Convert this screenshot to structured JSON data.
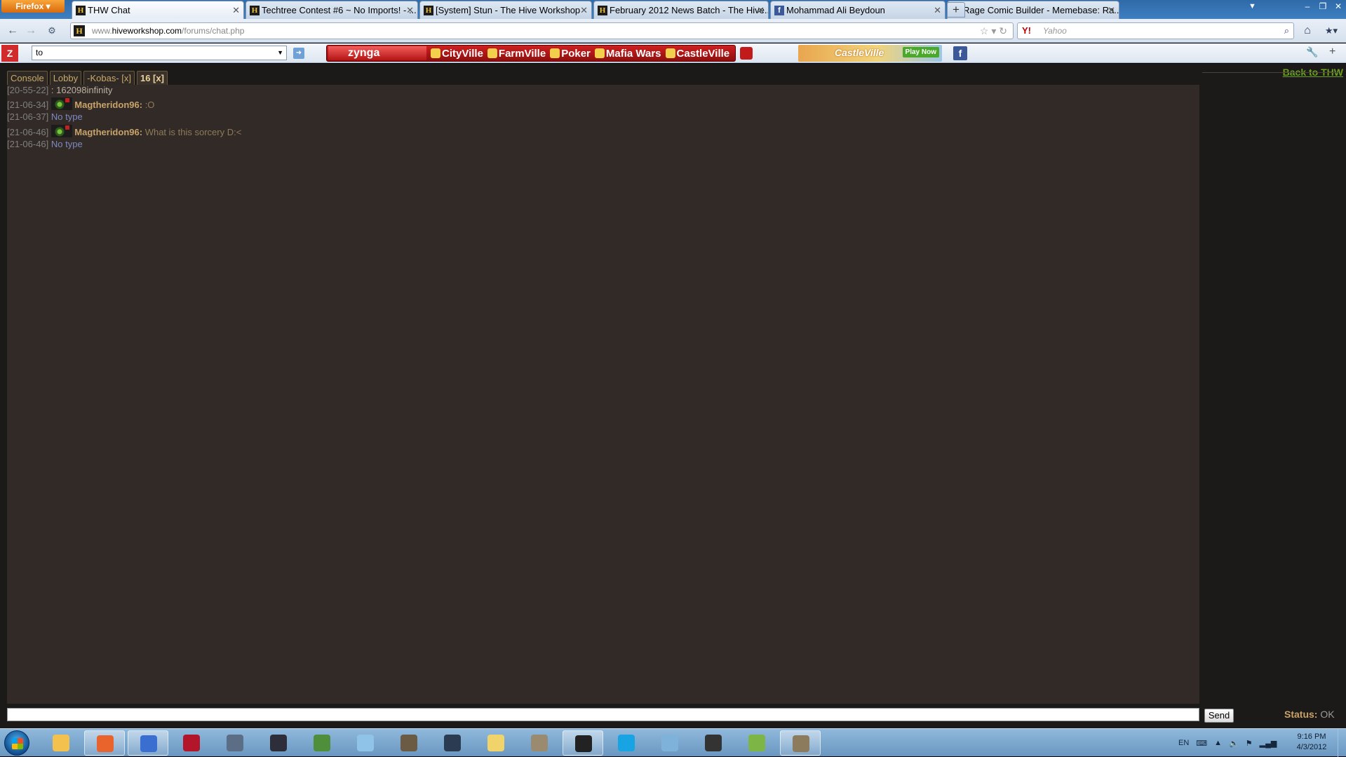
{
  "browser": {
    "menu_label": "Firefox",
    "tabs": [
      {
        "title": "THW Chat",
        "icon": "H"
      },
      {
        "title": "Techtree Contest #6 ~ No Imports! - ...",
        "icon": "H"
      },
      {
        "title": "[System] Stun - The Hive Workshop",
        "icon": "H"
      },
      {
        "title": "February 2012 News Batch - The Hive...",
        "icon": "H"
      },
      {
        "title": "Mohammad Ali Beydoun",
        "icon": "f"
      },
      {
        "title": "Rage Comic Builder - Memebase: Ra...",
        "icon": "M"
      }
    ],
    "url_prefix": "www.",
    "url_host": "hiveworkshop.com",
    "url_path": "/forums/chat.php",
    "search_engine": "Y!",
    "search_placeholder": "Yahoo"
  },
  "zynga_toolbar": {
    "search_value": "to",
    "logo": "zynga",
    "games": [
      "CityVille",
      "FarmVille",
      "Poker",
      "Mafia Wars",
      "CastleVille"
    ],
    "banner_title": "CastleVille",
    "banner_button": "Play Now",
    "fb_badge": "f"
  },
  "chat": {
    "tabs": [
      "Console",
      "Lobby",
      "-Kobas- [x]",
      "16 [x]"
    ],
    "back_link": "Back to THW",
    "messages": [
      {
        "ts": "[20-55-22]",
        "nick": "",
        "text": ": 162098infinity",
        "type": "plain"
      },
      {
        "ts": "[21-06-34]",
        "nick": "Magtheridon96:",
        "text": ":O",
        "type": "user"
      },
      {
        "ts": "[21-06-37]",
        "nick": "",
        "text": "No type",
        "type": "system"
      },
      {
        "ts": "[21-06-46]",
        "nick": "Magtheridon96:",
        "text": "What is this sorcery D:<",
        "type": "user"
      },
      {
        "ts": "[21-06-46]",
        "nick": "",
        "text": "No type",
        "type": "system"
      }
    ],
    "input_value": "",
    "send_label": "Send",
    "status_label": "Status:",
    "status_value": "OK"
  },
  "taskbar": {
    "lang": "EN",
    "time": "9:16 PM",
    "date": "4/3/2012",
    "app_colors": [
      "#f2c14e",
      "#e8642c",
      "#3a6fd1",
      "#b3162b",
      "#5b6e86",
      "#2e2e3a",
      "#4f8e3a",
      "#8fc3e8",
      "#6b5a44",
      "#2a3b52",
      "#f1d36b",
      "#9a8a6f",
      "#222222",
      "#18a3e2",
      "#7fb2da",
      "#333333",
      "#7db646",
      "#8c7b5c"
    ]
  },
  "colors": {
    "chat_bg": "#322a27",
    "nick": "#c8a36a",
    "system_text": "#7b8ac0",
    "link": "#6b9f1e"
  }
}
